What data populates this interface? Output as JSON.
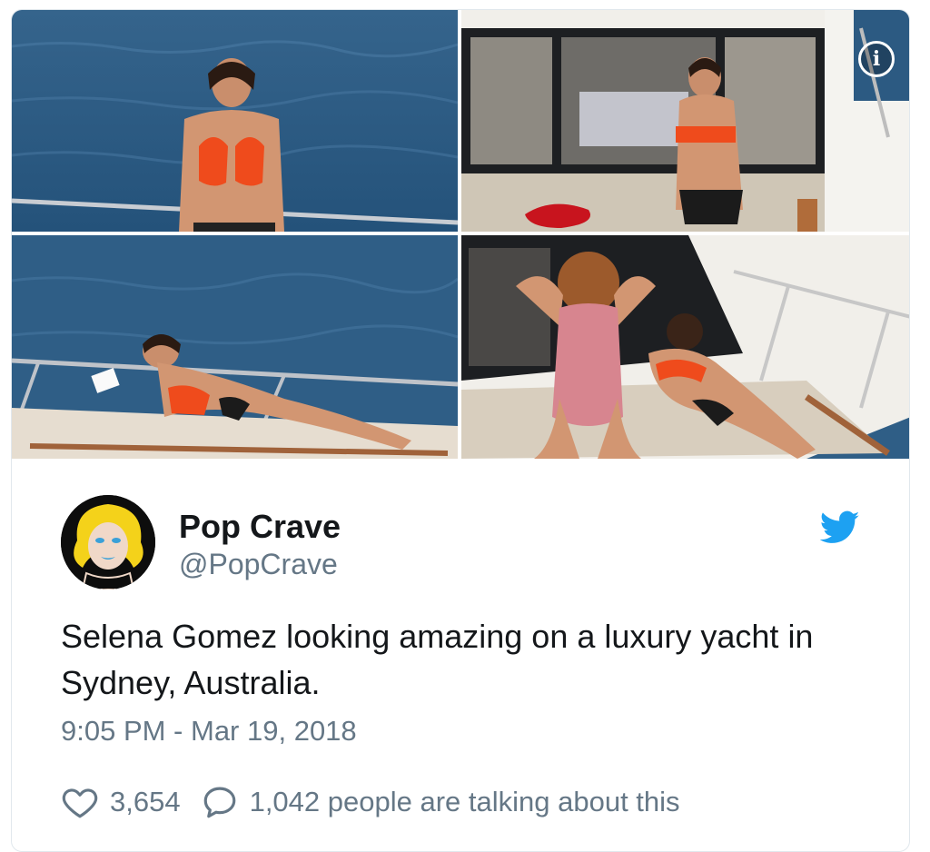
{
  "tweet": {
    "display_name": "Pop Crave",
    "handle": "@PopCrave",
    "text": "Selena Gomez looking amazing on a luxury yacht in Sydney, Australia.",
    "timestamp": "9:05 PM - Mar 19, 2018",
    "likes": "3,654",
    "talking": "1,042 people are talking about this"
  },
  "media": {
    "info_label": "i",
    "photo_count": 4
  },
  "colors": {
    "twitter_blue": "#1da1f2",
    "text_primary": "#14171a",
    "text_secondary": "#657786",
    "border": "#e1e8ed",
    "water": "#2c5a82",
    "swimsuit_orange": "#ef4b1c"
  },
  "icons": {
    "info": "info-icon",
    "brand": "twitter-bird-icon",
    "like": "heart-icon",
    "reply": "speech-bubble-icon"
  }
}
